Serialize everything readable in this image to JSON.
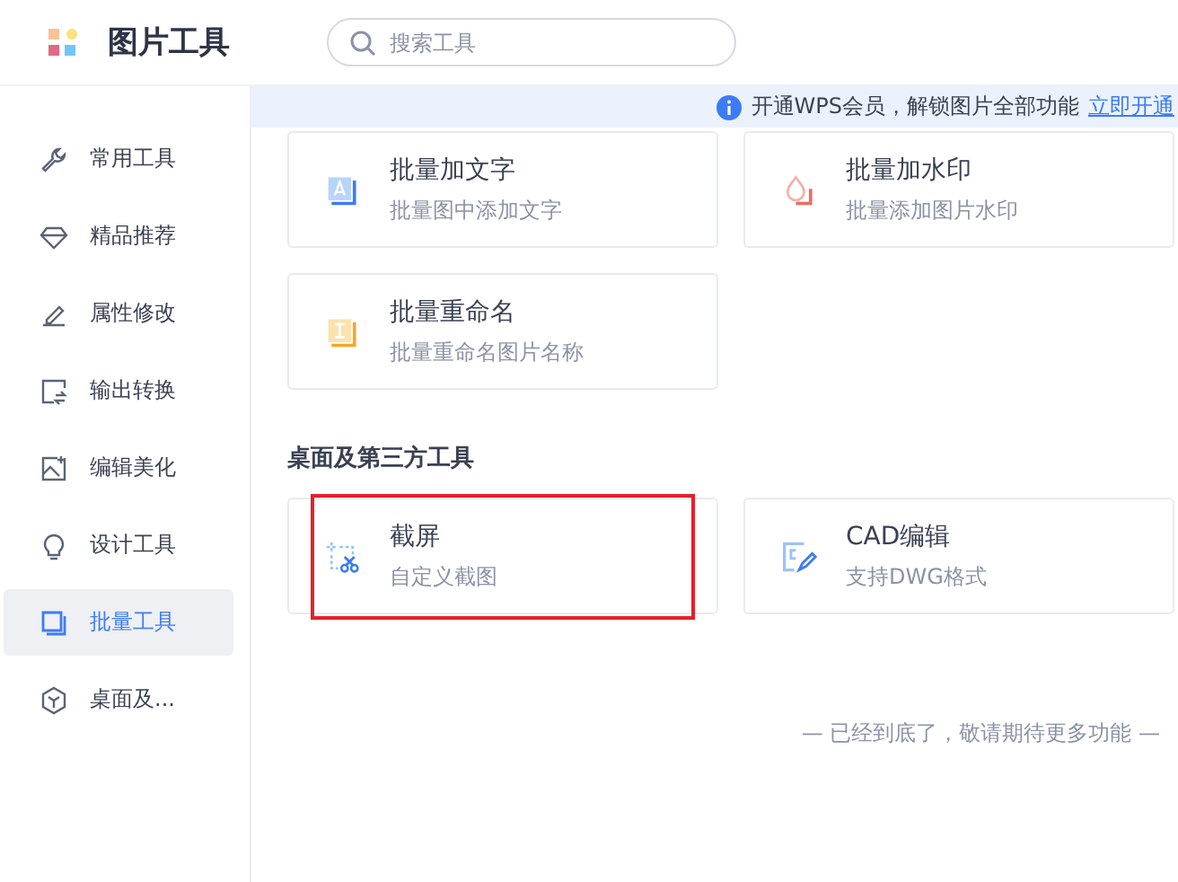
{
  "app": {
    "title": "图片工具"
  },
  "search": {
    "placeholder": "搜索工具"
  },
  "sidebar": {
    "items": [
      {
        "label": "常用工具",
        "kind": "wrench",
        "selected": false
      },
      {
        "label": "精品推荐",
        "kind": "diamond",
        "selected": false
      },
      {
        "label": "属性修改",
        "kind": "pen",
        "selected": false
      },
      {
        "label": "输出转换",
        "kind": "convert",
        "selected": false
      },
      {
        "label": "编辑美化",
        "kind": "image",
        "selected": false
      },
      {
        "label": "设计工具",
        "kind": "bulb",
        "selected": false
      },
      {
        "label": "批量工具",
        "kind": "layers",
        "selected": true
      },
      {
        "label": "桌面及...",
        "kind": "cube",
        "selected": false
      }
    ]
  },
  "banner": {
    "text": "开通WPS会员，解锁图片全部功能",
    "link": "立即开通"
  },
  "sections": [
    {
      "tools": [
        {
          "kind": "text",
          "title": "批量加文字",
          "subtitle": "批量图中添加文字",
          "highlighted": false
        },
        {
          "kind": "watermark",
          "title": "批量加水印",
          "subtitle": "批量添加图片水印",
          "highlighted": false
        },
        {
          "kind": "rename",
          "title": "批量重命名",
          "subtitle": "批量重命名图片名称",
          "highlighted": false
        }
      ]
    },
    {
      "heading": "桌面及第三方工具",
      "tools": [
        {
          "kind": "screenshot",
          "title": "截屏",
          "subtitle": "自定义截图",
          "highlighted": true
        },
        {
          "kind": "cad",
          "title": "CAD编辑",
          "subtitle": "支持DWG格式",
          "highlighted": false
        }
      ]
    }
  ],
  "footer": "— 已经到底了，敬请期待更多功能 —"
}
